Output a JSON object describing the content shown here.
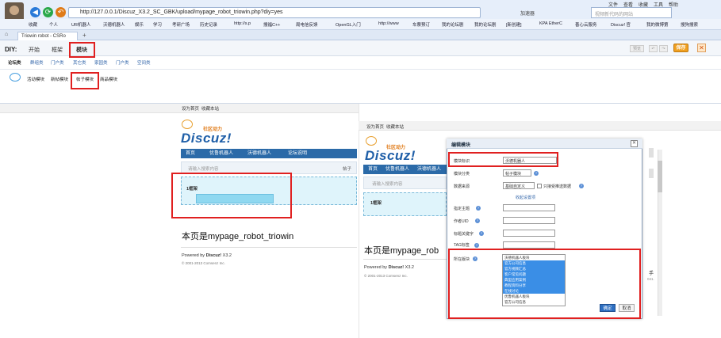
{
  "browser": {
    "menu": [
      "文件",
      "查看",
      "收藏",
      "工具",
      "帮助"
    ],
    "url": "http://127.0.0.1/Discuz_X3.2_SC_GBK/upload/mypage_robot_triowin.php?diy=yes",
    "speed_label": "加速器",
    "search_placeholder": "视频新代码的网站",
    "bookmarks": [
      "收藏",
      "个人",
      "UR机器人",
      "沃德机器人",
      "娱乐",
      "学习",
      "考研广场",
      "历史记录",
      "http://s.p",
      "搜福C++",
      "局电信反馈",
      "OpenGL入门",
      "http://www",
      "车票预订",
      "我的论坛剧",
      "我的论坛剧",
      "[新创建]",
      "KPA EtherC",
      "善心云服务",
      "Discuz! 官",
      "我的微博第",
      "搜狗搜索"
    ],
    "tab_title": "Triowin robot - CSRo",
    "new_tab": "+"
  },
  "diy": {
    "label": "DIY:",
    "tabs": [
      "开始",
      "框架",
      "模块"
    ],
    "subtabs": [
      "论坛类",
      "群组类",
      "门户类",
      "其它类",
      "家园类",
      "门户类",
      "空间类"
    ],
    "modules": [
      "活动模块",
      "新帖模块",
      "帖子模块",
      "商品模块"
    ],
    "buttons": {
      "preview": "预览",
      "undo": "↶",
      "redo": "↷",
      "save": "保存",
      "close": "✕"
    }
  },
  "left_page": {
    "top_links": [
      "设为首页",
      "收藏本站"
    ],
    "logo_sub": "社区动力",
    "logo": "Discuz!",
    "nav": [
      "首页",
      "优鲁机器人",
      "沃德机器人",
      "论坛说明"
    ],
    "search_placeholder": "请输入搜索内容",
    "search_scope": "帖子",
    "frame_label": "1框架",
    "heading": "本页是mypage_robot_triowin",
    "powered_prefix": "Powered by ",
    "powered_brand": "Discuz!",
    "powered_version": " X3.2",
    "copyright": "© 2001-2013 Comsenz Inc."
  },
  "right_page": {
    "top_links": [
      "设为首页",
      "收藏本站"
    ],
    "logo_sub": "社区动力",
    "logo": "Discuz!",
    "nav": [
      "首页",
      "优鲁机器人",
      "沃德机器人"
    ],
    "search_placeholder": "请输入搜索内容",
    "frame_label": "1框架",
    "heading": "本页是mypage_rob",
    "powered_prefix": "Powered by ",
    "powered_brand": "Discuz!",
    "powered_version": " X3.2",
    "copyright": "© 2001-2013 Comsenz Inc.",
    "edge_text": "手",
    "edge_text2": "041."
  },
  "dialog": {
    "title": "编辑模块",
    "close": "✕",
    "fields": {
      "block_title_label": "模块标识",
      "block_title_value": "沃德机器人",
      "block_category_label": "模块分类",
      "block_category_value": "帖子模块",
      "data_source_label": "数据来源",
      "data_source_value": "基础自定义",
      "recommended_only_label": "只接受推送数据",
      "collapse_link": "收起设置项",
      "specify_topic_label": "指定主题",
      "author_uid_label": "作者UID",
      "title_keyword_label": "标题关键字",
      "tag_label": "TAG标签",
      "forum_label": "所在版块"
    },
    "forum_options": [
      {
        "text": "沃德机器人板块",
        "selected": false
      },
      {
        "text": "官方公司信息",
        "selected": true
      },
      {
        "text": "官方视频汇总",
        "selected": true
      },
      {
        "text": "客户常见问题",
        "selected": true
      },
      {
        "text": "典型应用案例",
        "selected": true
      },
      {
        "text": "教程资料分享",
        "selected": true
      },
      {
        "text": "在线讨论",
        "selected": true
      },
      {
        "text": "优鲁机器人板块",
        "selected": false
      },
      {
        "text": "官方公司信息",
        "selected": false
      }
    ],
    "ok": "确定",
    "cancel": "取消"
  },
  "colors": {
    "accent": "#2b6aa8",
    "highlight": "#e02020",
    "save": "#f0a020"
  }
}
